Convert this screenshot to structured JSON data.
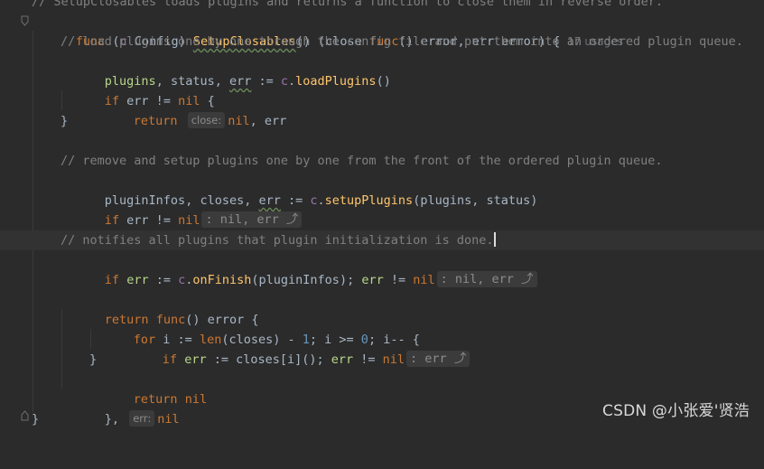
{
  "editor": {
    "language": "Go",
    "colors": {
      "background": "#2b2b2b",
      "keyword": "#cc7832",
      "function": "#ffc66d",
      "receiver": "#9876aa",
      "number": "#6897bb",
      "comment": "#808080",
      "local_var": "#b9d68a",
      "default_text": "#a9b7c6"
    },
    "line0_comment": "// SetupClosables loads plugins and returns a function to close them in reverse order.",
    "line1": {
      "kw_func": "func",
      "open_paren": " (",
      "receiver": "c",
      "recv_type": " Config) ",
      "func_name": "SetupClosables",
      "signature_rest": "() (close ",
      "kw_func2": "func",
      "sig_tail": "() error, err error) {",
      "usages": "17 usages"
    },
    "line2_comment": "// load plugins one by one through the config file and put them into an ordered plugin queue.",
    "line3": {
      "plugins": "plugins",
      "comma": ", status, ",
      "err": "err",
      "assign": " := ",
      "recv": "c",
      "call": ".loadPlugins()",
      "method": "loadPlugins"
    },
    "line4": {
      "kw_if": "if",
      "rest": " err != ",
      "nil": "nil",
      "brace": " {"
    },
    "line5": {
      "kw_return": "return",
      "hint": "close:",
      "nil": "nil",
      "rest": ", err"
    },
    "line6": "}",
    "line8_comment": "// remove and setup plugins one by one from the front of the ordered plugin queue.",
    "line9": {
      "a": "pluginInfos",
      "b": ", closes, ",
      "err": "err",
      "assign": " := ",
      "recv": "c",
      "dot": ".",
      "method": "setupPlugins",
      "args": "(plugins, status)"
    },
    "line10": {
      "kw_if": "if",
      "rest": " err != ",
      "nil": "nil",
      "fold": ": nil, err ⤴"
    },
    "line12_comment": "// notifies all plugins that plugin initialization is done.",
    "line13": {
      "kw_if": "if",
      "err": "err",
      "assign": " := ",
      "recv": "c",
      "dot": ".",
      "method": "onFinish",
      "args": "(pluginInfos); ",
      "err2": "err",
      "cmp": " != ",
      "nil": "nil",
      "fold": ": nil, err ⤴"
    },
    "line15": {
      "kw_return": "return",
      "kw_func": "func",
      "rest": "() error {"
    },
    "line16": {
      "kw_for": "for",
      "i": " i := ",
      "len": "len",
      "mid": "(closes) - ",
      "one": "1",
      "semi": "; i >= ",
      "zero": "0",
      "tail": "; i-- {"
    },
    "line17": {
      "kw_if": "if",
      "err": "err",
      "assign": " := closes[i](); ",
      "err2": "err",
      "cmp": " != ",
      "nil": "nil",
      "fold": ": err ⤴"
    },
    "line18": "}",
    "line19": {
      "kw_return": "return",
      "nil": "nil"
    },
    "line20": {
      "close": "},",
      "hint": "err:",
      "nil": "nil"
    },
    "line21": "}"
  },
  "watermark": "CSDN @小张爱'贤浩"
}
